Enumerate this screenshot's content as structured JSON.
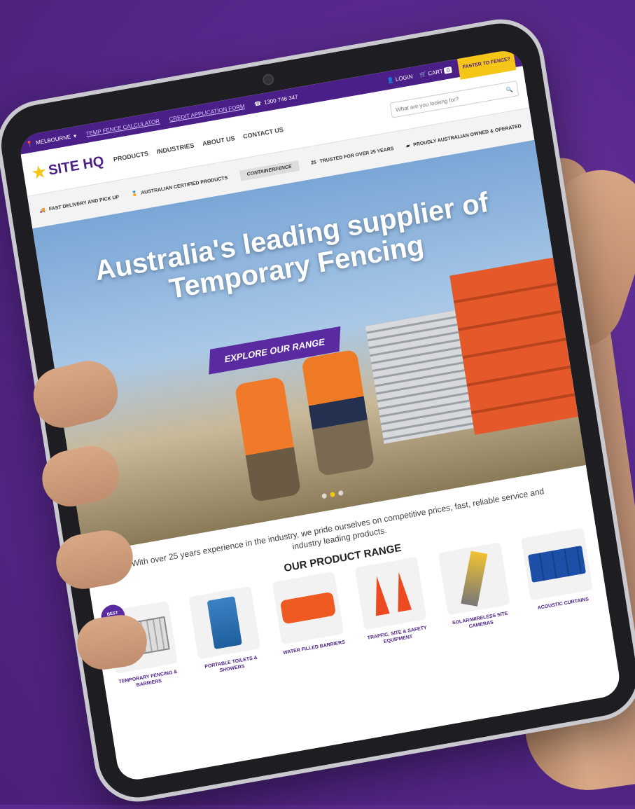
{
  "topbar": {
    "location": "MELBOURNE",
    "link_1": "TEMP FENCE CALCULATOR",
    "link_2": "CREDIT APPLICATION FORM",
    "phone": "1300 748 347",
    "login": "LOGIN",
    "cart": "CART",
    "cart_count": "0",
    "promo": "FASTER TO FENCE?"
  },
  "header": {
    "logo_text": "SITE HQ",
    "nav": [
      "PRODUCTS",
      "INDUSTRIES",
      "ABOUT US",
      "CONTACT US"
    ],
    "search_placeholder": "What are you looking for?"
  },
  "trust": {
    "delivery": "FAST DELIVERY AND PICK UP",
    "certified": "AUSTRALIAN CERTIFIED PRODUCTS",
    "partner": "CONTAINERFENCE",
    "years_num": "25",
    "years_label": "TRUSTED FOR OVER 25 YEARS",
    "owned": "PROUDLY AUSTRALIAN OWNED & OPERATED"
  },
  "hero": {
    "headline": "Australia's leading supplier of Temporary Fencing",
    "cta": "EXPLORE OUR RANGE"
  },
  "intro": "With over 25 years experience in the industry, we pride ourselves on competitive prices, fast, reliable service and industry leading products.",
  "range_title": "OUR PRODUCT RANGE",
  "products": [
    {
      "name": "TEMPORARY FENCING & BARRIERS",
      "badge": "BEST SELLING"
    },
    {
      "name": "PORTABLE TOILETS & SHOWERS"
    },
    {
      "name": "WATER FILLED BARRIERS"
    },
    {
      "name": "TRAFFIC, SITE & SAFETY EQUIPMENT"
    },
    {
      "name": "SOLAR/WIRELESS SITE CAMERAS"
    },
    {
      "name": "ACOUSTIC CURTAINS"
    }
  ],
  "colors": {
    "background": "#5b2a8e",
    "brand_purple": "#4b1f88",
    "accent_yellow": "#f5c518",
    "orange": "#ee5a22"
  }
}
